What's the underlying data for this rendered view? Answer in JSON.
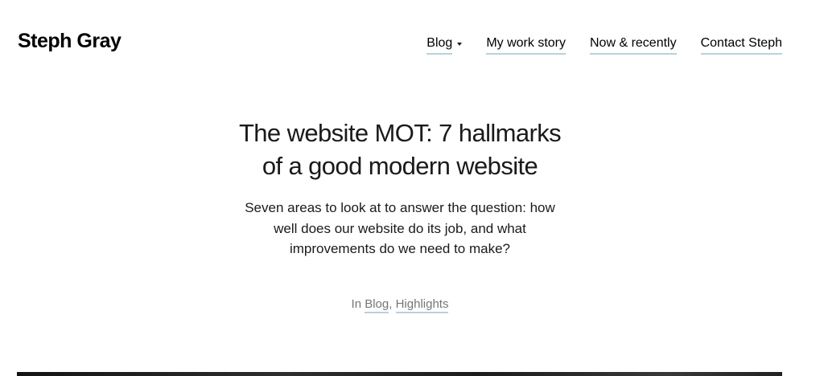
{
  "site": {
    "title": "Steph Gray"
  },
  "nav": {
    "items": [
      {
        "label": "Blog",
        "has_dropdown": true
      },
      {
        "label": "My work story"
      },
      {
        "label": "Now & recently"
      },
      {
        "label": "Contact Steph"
      }
    ],
    "dropdown_icon": "caret-down-icon",
    "underline_color": "#b8d1dc"
  },
  "post": {
    "title_line1": "The website MOT: 7 hallmarks",
    "title_line2": "of a good modern website",
    "excerpt_line1": "Seven areas to look at to answer the question: how",
    "excerpt_line2": "well does our website do its job, and what",
    "excerpt_line3": "improvements do we need to make?",
    "meta_prefix": "In",
    "categories": [
      "Blog",
      "Highlights"
    ],
    "category_separator": ","
  },
  "colors": {
    "text": "#1a1a1a",
    "meta_text": "#767676",
    "link_underline": "#b8d1dc",
    "background": "#ffffff"
  }
}
